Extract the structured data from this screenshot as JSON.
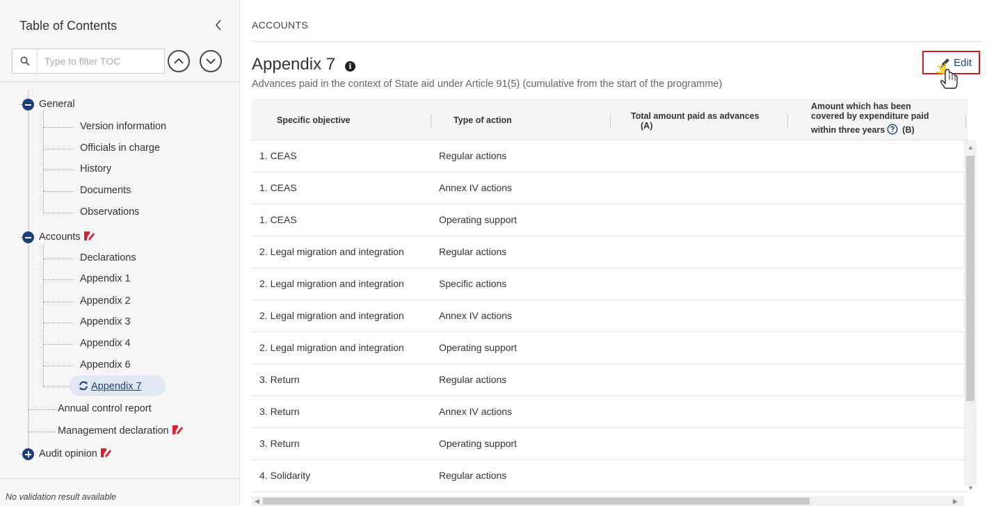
{
  "sidebar": {
    "title": "Table of Contents",
    "filter_placeholder": "Type to filter TOC",
    "tree": {
      "general": {
        "label": "General",
        "children": [
          "Version information",
          "Officials in charge",
          "History",
          "Documents",
          "Observations"
        ]
      },
      "accounts": {
        "label": "Accounts",
        "children": [
          "Declarations",
          "Appendix 1",
          "Appendix 2",
          "Appendix 3",
          "Appendix 4",
          "Appendix 6",
          "Appendix 7"
        ],
        "active_child": "Appendix 7"
      },
      "annual_control_report": "Annual control report",
      "management_declaration": "Management declaration",
      "audit_opinion": "Audit opinion"
    },
    "validation_text": "No validation result available"
  },
  "main": {
    "breadcrumb": "ACCOUNTS",
    "title": "Appendix 7",
    "subtitle": "Advances paid in the context of State aid under Article 91(5) (cumulative from the start of the programme)",
    "edit_label": "Edit"
  },
  "table": {
    "headers": {
      "specific_objective": "Specific objective",
      "type_of_action": "Type of action",
      "total_amount_line1": "Total amount paid as advances",
      "total_amount_line2": "(A)",
      "covered_line1": "Amount which has been",
      "covered_line2": "covered by expenditure paid",
      "covered_line3": "within three years",
      "covered_suffix": "(B)"
    },
    "rows": [
      {
        "objective": "1. CEAS",
        "action": "Regular actions"
      },
      {
        "objective": "1. CEAS",
        "action": "Annex IV actions"
      },
      {
        "objective": "1. CEAS",
        "action": "Operating support"
      },
      {
        "objective": "2. Legal migration and integration",
        "action": "Regular actions"
      },
      {
        "objective": "2. Legal migration and integration",
        "action": "Specific actions"
      },
      {
        "objective": "2. Legal migration and integration",
        "action": "Annex IV actions"
      },
      {
        "objective": "2. Legal migration and integration",
        "action": "Operating support"
      },
      {
        "objective": "3. Return",
        "action": "Regular actions"
      },
      {
        "objective": "3. Return",
        "action": "Annex IV actions"
      },
      {
        "objective": "3. Return",
        "action": "Operating support"
      },
      {
        "objective": "4. Solidarity",
        "action": "Regular actions"
      }
    ]
  },
  "colors": {
    "accent": "#1b3f79",
    "edit_highlight": "#c9191e",
    "flag": "#d9232e"
  }
}
